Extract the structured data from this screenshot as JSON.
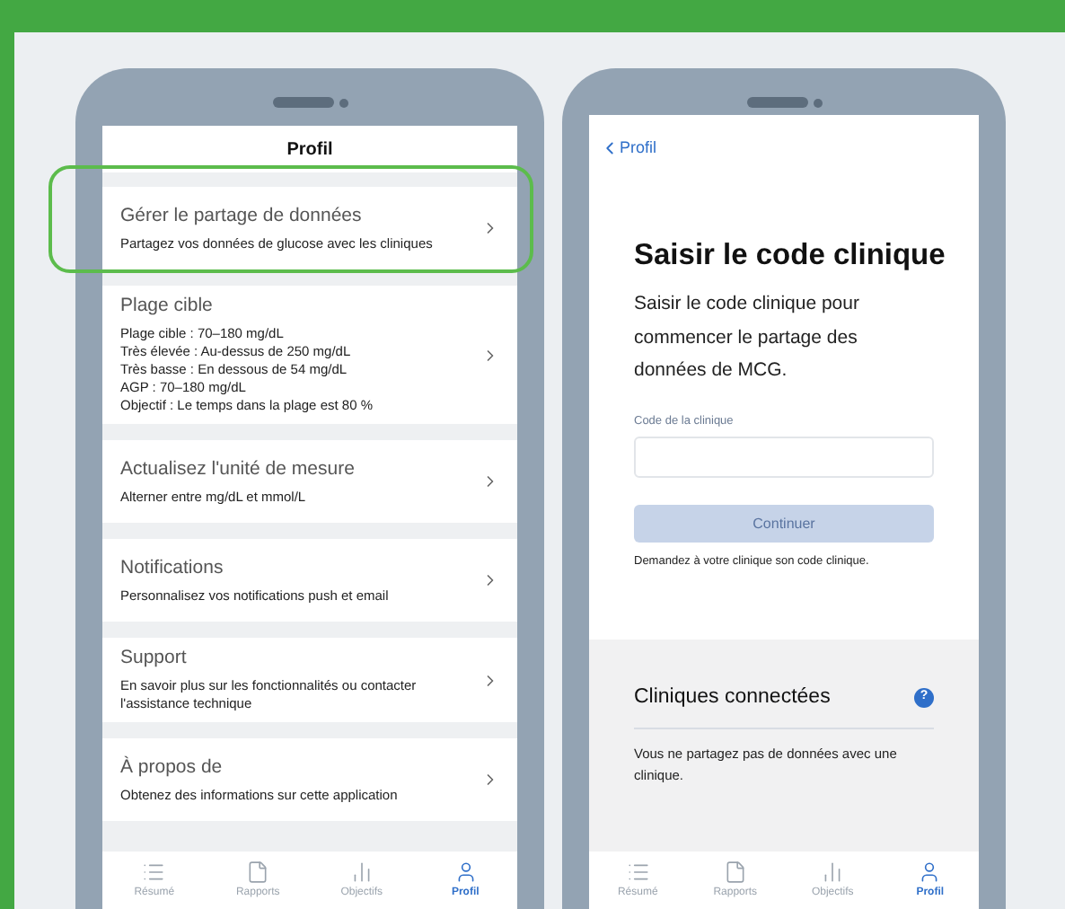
{
  "left_screen": {
    "header_title": "Profil",
    "items": [
      {
        "title": "Gérer le partage de données",
        "lines": [
          "Partagez vos données de glucose avec les cliniques"
        ],
        "highlighted": true
      },
      {
        "title": "Plage cible",
        "lines": [
          "Plage cible : 70–180 mg/dL",
          "Très élevée : Au-dessus de 250 mg/dL",
          "Très basse : En dessous de 54 mg/dL",
          "AGP : 70–180 mg/dL",
          "Objectif : Le temps dans la plage est 80 %"
        ],
        "highlighted": false
      },
      {
        "title": "Actualisez l'unité de mesure",
        "lines": [
          "Alterner entre mg/dL et mmol/L"
        ],
        "highlighted": false
      },
      {
        "title": "Notifications",
        "lines": [
          "Personnalisez vos notifications push et email"
        ],
        "highlighted": false
      },
      {
        "title": "Support",
        "lines": [
          "En savoir plus sur les fonctionnalités ou contacter l'assistance technique"
        ],
        "highlighted": false
      },
      {
        "title": "À propos de",
        "lines": [
          "Obtenez des informations sur cette application"
        ],
        "highlighted": false
      }
    ],
    "tab_bar": [
      {
        "label": "Résumé",
        "kind": "list",
        "selected": false
      },
      {
        "label": "Rapports",
        "kind": "file",
        "selected": false
      },
      {
        "label": "Objectifs",
        "kind": "chart",
        "selected": false
      },
      {
        "label": "Profil",
        "kind": "user",
        "selected": true
      }
    ]
  },
  "right_screen": {
    "back_link": "Profil",
    "title": "Saisir le code clinique",
    "description": "Saisir le code clinique pour commencer le partage des données de MCG.",
    "field": {
      "label": "Code de la clinique"
    },
    "button": {
      "label": "Continuer",
      "disabled": true
    },
    "hint": "Demandez à votre clinique son code clinique.",
    "connected": {
      "title": "Cliniques connectées",
      "help": "?",
      "message": "Vous ne partagez pas de données avec une clinique."
    },
    "tab_bar": [
      {
        "label": "Résumé",
        "kind": "list",
        "selected": false
      },
      {
        "label": "Rapports",
        "kind": "file",
        "selected": false
      },
      {
        "label": "Objectifs",
        "kind": "chart",
        "selected": false
      },
      {
        "label": "Profil",
        "kind": "user",
        "selected": true
      }
    ]
  }
}
